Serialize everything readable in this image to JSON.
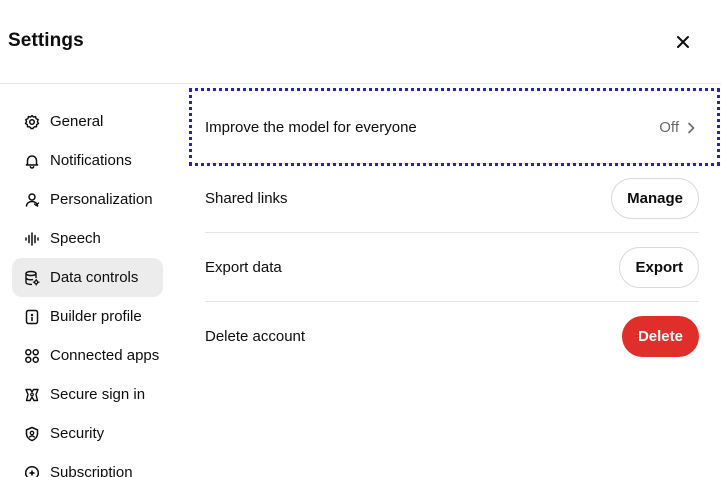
{
  "header": {
    "title": "Settings",
    "close_icon": "close-icon"
  },
  "sidebar": {
    "items": [
      {
        "label": "General",
        "icon": "gear-icon",
        "active": false
      },
      {
        "label": "Notifications",
        "icon": "bell-icon",
        "active": false
      },
      {
        "label": "Personalization",
        "icon": "person-icon",
        "active": false
      },
      {
        "label": "Speech",
        "icon": "waveform-icon",
        "active": false
      },
      {
        "label": "Data controls",
        "icon": "database-icon",
        "active": true
      },
      {
        "label": "Builder profile",
        "icon": "id-card-icon",
        "active": false
      },
      {
        "label": "Connected apps",
        "icon": "apps-icon",
        "active": false
      },
      {
        "label": "Secure sign in",
        "icon": "key-icon",
        "active": false
      },
      {
        "label": "Security",
        "icon": "shield-icon",
        "active": false
      },
      {
        "label": "Subscription",
        "icon": "plus-circle-icon",
        "active": false
      }
    ]
  },
  "main": {
    "rows": [
      {
        "label": "Improve the model for everyone",
        "value": "Off"
      },
      {
        "label": "Shared links",
        "button": "Manage"
      },
      {
        "label": "Export data",
        "button": "Export"
      },
      {
        "label": "Delete account",
        "button": "Delete"
      }
    ]
  },
  "colors": {
    "danger": "#e02e2a",
    "highlight": "#1f1fd6",
    "active_bg": "#ececec"
  }
}
